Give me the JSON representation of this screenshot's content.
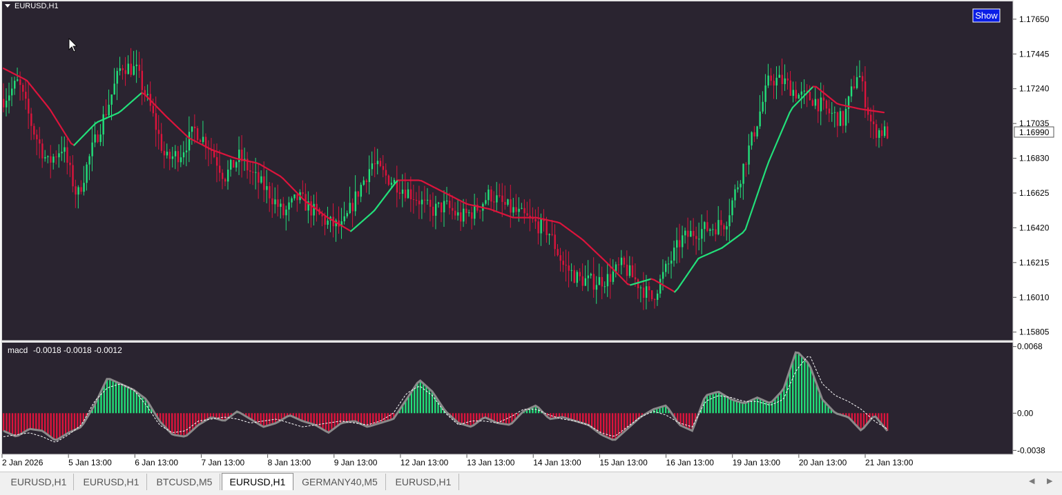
{
  "window": {
    "symbol_title": "EURUSD,H1",
    "show_button_label": "Show"
  },
  "colors": {
    "background": "#2a2430",
    "bull": "#22e07a",
    "bear": "#dc143c",
    "grid_border": "#cfcfcf",
    "macd_line": "#8a8a8a",
    "signal_line": "#ffffff",
    "show_button_bg": "#0a1ee6"
  },
  "chart_data": [
    {
      "type": "candlestick",
      "title": "EURUSD,H1",
      "ylim": [
        1.15755,
        1.17755
      ],
      "y_ticks": [
        "1.17650",
        "1.17445",
        "1.17240",
        "1.17035",
        "1.16830",
        "1.16625",
        "1.16420",
        "1.16215",
        "1.16010",
        "1.15805"
      ],
      "current_price_label": "1.16990",
      "x_ticks": [
        "2 Jan 2026",
        "5 Jan 13:00",
        "6 Jan 13:00",
        "7 Jan 13:00",
        "8 Jan 13:00",
        "9 Jan 13:00",
        "12 Jan 13:00",
        "13 Jan 13:00",
        "14 Jan 13:00",
        "15 Jan 13:00",
        "16 Jan 13:00",
        "19 Jan 13:00",
        "20 Jan 13:00",
        "21 Jan 13:00"
      ],
      "close_anchors": [
        1.1718,
        1.1728,
        1.17,
        1.168,
        1.169,
        1.166,
        1.1688,
        1.1712,
        1.1738,
        1.1735,
        1.1712,
        1.1682,
        1.1686,
        1.17,
        1.169,
        1.1672,
        1.1684,
        1.1672,
        1.1663,
        1.165,
        1.166,
        1.1652,
        1.1645,
        1.1642,
        1.1662,
        1.168,
        1.1672,
        1.1666,
        1.166,
        1.1652,
        1.1655,
        1.1648,
        1.1652,
        1.1662,
        1.1655,
        1.165,
        1.1645,
        1.164,
        1.162,
        1.1612,
        1.161,
        1.1612,
        1.162,
        1.161,
        1.16,
        1.1618,
        1.1635,
        1.164,
        1.1642,
        1.1645,
        1.1672,
        1.17,
        1.173,
        1.1728,
        1.172,
        1.1718,
        1.171,
        1.1705,
        1.1735,
        1.17,
        1.1698
      ],
      "series": [
        {
          "name": "",
          "type": "moving-average",
          "anchors": [
            1.1736,
            1.1729,
            1.1712,
            1.169,
            1.1704,
            1.171,
            1.1722,
            1.1708,
            1.1695,
            1.1688,
            1.1683,
            1.168,
            1.1672,
            1.1658,
            1.1648,
            1.164,
            1.1652,
            1.167,
            1.167,
            1.1663,
            1.1656,
            1.1653,
            1.1648,
            1.1648,
            1.1645,
            1.1635,
            1.1622,
            1.1608,
            1.1612,
            1.1604,
            1.1624,
            1.163,
            1.164,
            1.168,
            1.1712,
            1.1726,
            1.1715,
            1.1712,
            1.171
          ]
        }
      ]
    },
    {
      "type": "macd",
      "label": "macd",
      "values_text": "-0.0018 -0.0018 -0.0012",
      "ylim": [
        -0.0042,
        0.0072
      ],
      "y_ticks": [
        "0.0068",
        "0.00",
        "-0.0038"
      ],
      "histogram_anchors": [
        -0.0018,
        -0.0024,
        -0.0016,
        -0.0018,
        -0.0028,
        -0.002,
        -0.0014,
        0.0008,
        0.0036,
        0.003,
        0.0024,
        0.0014,
        -0.0008,
        -0.0022,
        -0.0024,
        -0.0012,
        -0.0004,
        -0.0008,
        0.0002,
        -0.0006,
        -0.0014,
        -0.001,
        -0.0002,
        -0.0008,
        -0.0012,
        -0.002,
        -0.001,
        -0.0008,
        -0.0014,
        -0.001,
        -0.0006,
        0.0014,
        0.0034,
        0.0022,
        0.0002,
        -0.001,
        -0.0014,
        -0.0004,
        -0.001,
        -0.0012,
        0.0002,
        0.0008,
        -0.0006,
        -0.0004,
        -0.0008,
        -0.0012,
        -0.0022,
        -0.0028,
        -0.0016,
        -0.0004,
        0.0004,
        0.0008,
        -0.0012,
        -0.0018,
        0.0018,
        0.0022,
        0.0014,
        0.001,
        0.0016,
        0.001,
        0.0024,
        0.0064,
        0.005,
        0.0014,
        0.0,
        -0.0004,
        -0.0018,
        -0.0002,
        -0.0018
      ],
      "signal_anchors": [
        -0.0024,
        -0.0022,
        -0.002,
        -0.0024,
        -0.003,
        -0.0022,
        -0.0012,
        0.0012,
        0.0026,
        0.003,
        0.0024,
        0.0008,
        -0.0012,
        -0.002,
        -0.0018,
        -0.0008,
        -0.0006,
        -0.0004,
        -0.0006,
        -0.001,
        -0.0008,
        -0.0006,
        -0.001,
        -0.0014,
        -0.0012,
        -0.001,
        -0.0008,
        -0.001,
        -0.0012,
        -0.0008,
        0.0,
        0.002,
        0.0028,
        0.0018,
        0.0,
        -0.0012,
        -0.0008,
        -0.0008,
        -0.001,
        -0.0004,
        0.0004,
        0.0004,
        -0.0002,
        -0.0006,
        -0.0008,
        -0.0012,
        -0.002,
        -0.0024,
        -0.0014,
        -0.0004,
        0.0002,
        -0.0002,
        -0.001,
        -0.0014,
        0.0012,
        0.0018,
        0.0016,
        0.0012,
        0.0012,
        0.0008,
        0.0014,
        0.0044,
        0.006,
        0.003,
        0.0018,
        0.0012,
        0.0004,
        -0.0008,
        -0.0016
      ]
    }
  ],
  "tabs": [
    {
      "label": "EURUSD,H1",
      "active": false
    },
    {
      "label": "EURUSD,H1",
      "active": false
    },
    {
      "label": "BTCUSD,M5",
      "active": false
    },
    {
      "label": "EURUSD,H1",
      "active": true
    },
    {
      "label": "GERMANY40,M5",
      "active": false
    },
    {
      "label": "EURUSD,H1",
      "active": false
    }
  ],
  "icons": {
    "collapse": "triangle-down-icon",
    "cursor": "mouse-pointer-icon",
    "scroll_left": "scroll-left-icon",
    "scroll_right": "scroll-right-icon"
  }
}
